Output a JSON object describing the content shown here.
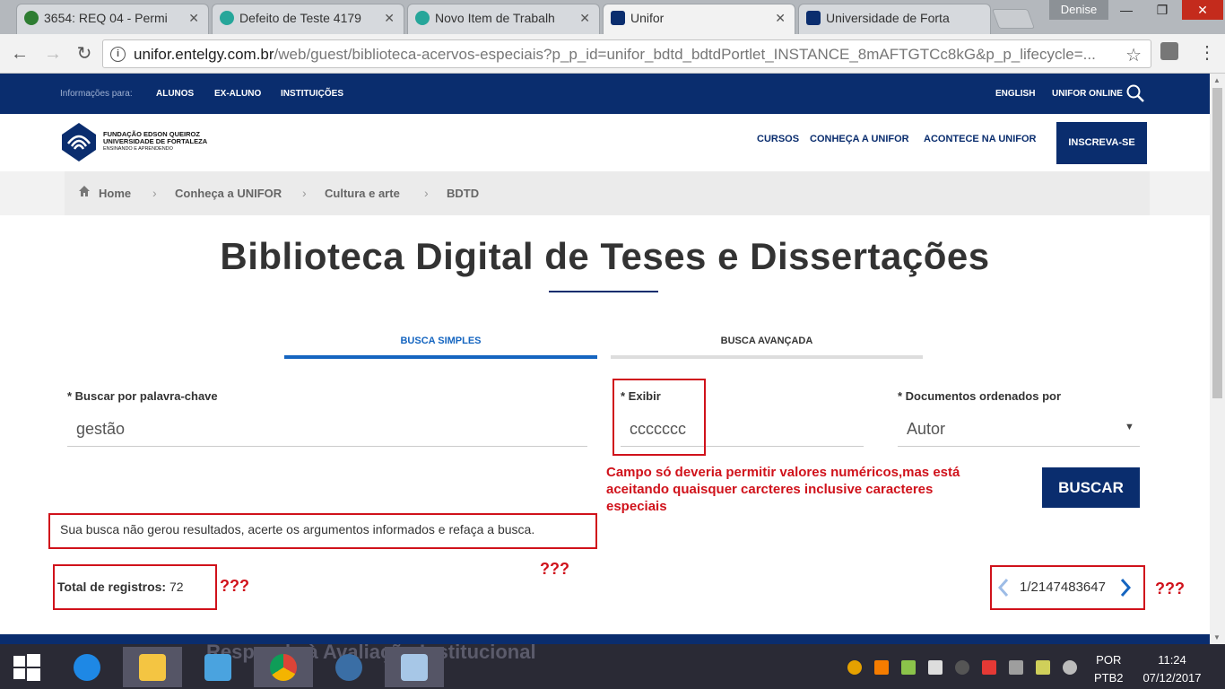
{
  "browser": {
    "tabs": [
      {
        "label": "3654: REQ 04 - Permi",
        "color": "#2e7d32"
      },
      {
        "label": "Defeito de Teste 4179",
        "color": "#26a69a"
      },
      {
        "label": "Novo Item de Trabalh",
        "color": "#26a69a"
      },
      {
        "label": "Unifor",
        "color": "#0a2d6e"
      },
      {
        "label": "Universidade de Forta",
        "color": "#0a2d6e"
      }
    ],
    "close_glyph": "✕",
    "user": "Denise",
    "window_buttons": {
      "minimize": "—",
      "maximize": "❐",
      "close": "✕"
    },
    "url_host": "unifor.entelgy.com.br",
    "url_path": "/web/guest/biblioteca-acervos-especiais?p_p_id=unifor_bdtd_bdtdPortlet_INSTANCE_8mAFTGTCc8kG&p_p_lifecycle=...",
    "nav": {
      "back": "←",
      "forward": "→",
      "reload": "↻",
      "info": "i",
      "star": "☆",
      "menu": "⋮"
    }
  },
  "topnav": {
    "label": "Informações para:",
    "links": [
      "ALUNOS",
      "EX-ALUNO",
      "INSTITUIÇÕES"
    ],
    "right_links": [
      "ENGLISH",
      "UNIFOR ONLINE"
    ]
  },
  "header": {
    "logo_line1": "FUNDAÇÃO EDSON QUEIROZ",
    "logo_line2": "UNIVERSIDADE DE FORTALEZA",
    "logo_line3": "ENSINANDO E APRENDENDO",
    "nav": [
      "CURSOS",
      "CONHEÇA A UNIFOR",
      "ACONTECE NA UNIFOR"
    ],
    "cta": "INSCREVA-SE"
  },
  "breadcrumb": {
    "items": [
      "Home",
      "Conheça a UNIFOR",
      "Cultura e arte",
      "BDTD"
    ],
    "separator": "›"
  },
  "page": {
    "title": "Biblioteca Digital de Teses e Dissertações",
    "tabs": [
      "BUSCA SIMPLES",
      "BUSCA AVANÇADA"
    ],
    "fields": {
      "keyword_label": "* Buscar por palavra-chave",
      "keyword_value": "gestão",
      "exibir_label": "* Exibir",
      "exibir_value": "ccccccc",
      "order_label": "* Documentos ordenados por",
      "order_value": "Autor",
      "order_arrow": "▼"
    },
    "search_button": "BUSCAR",
    "message": "Sua busca não gerou resultados, acerte os argumentos informados e refaça a busca.",
    "total_label": "Total de registros:",
    "total_value": "72",
    "pager_text": "1/2147483647"
  },
  "annotations": {
    "field_note": "Campo só deveria permitir valores numéricos,mas está aceitando quaisquer carcteres inclusive caracteres especiais",
    "q1": "???",
    "q2": "???",
    "q3": "???",
    "color": "#d0121b"
  },
  "taskbar": {
    "faded_text": "Responda à Avaliação Institucional",
    "lang_top": "POR",
    "lang_bottom": "PTB2",
    "time": "11:24",
    "date": "07/12/2017"
  }
}
